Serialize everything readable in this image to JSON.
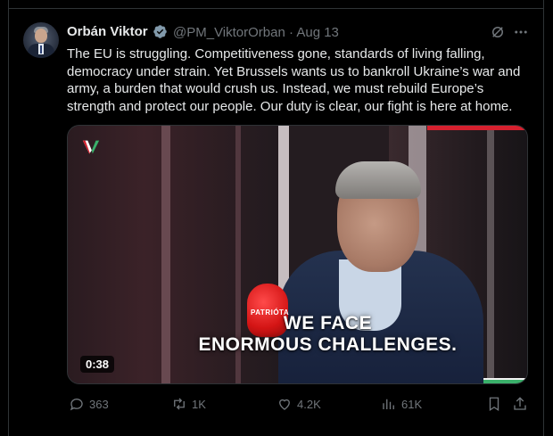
{
  "tweet": {
    "author_name": "Orbán Viktor",
    "handle": "@PM_ViktorOrban",
    "separator": "·",
    "date": "Aug 13",
    "text": "The EU is struggling. Competitiveness gone, standards of living falling, democracy under strain. Yet Brussels wants us to bankroll Ukraine’s war and army, a burden that would crush us. Instead, we must rebuild Europe’s strength and protect our people. Our duty is clear, our fight is here at home."
  },
  "video": {
    "caption_line1": "WE FACE",
    "caption_line2": "ENORMOUS CHALLENGES.",
    "duration": "0:38",
    "mic_text": "PATRIÓTA"
  },
  "actions": {
    "replies": "363",
    "reposts": "1K",
    "likes": "4.2K",
    "views": "61K"
  },
  "icons": {
    "verified": "verified-badge-icon",
    "grok": "grok-icon",
    "more": "more-icon",
    "reply": "reply-icon",
    "repost": "repost-icon",
    "like": "like-icon",
    "views": "views-icon",
    "bookmark": "bookmark-icon",
    "share": "share-icon"
  },
  "colors": {
    "background": "#000000",
    "text_primary": "#e7e9ea",
    "text_secondary": "#71767b",
    "border": "#2f3336",
    "verified": "#829aab"
  }
}
